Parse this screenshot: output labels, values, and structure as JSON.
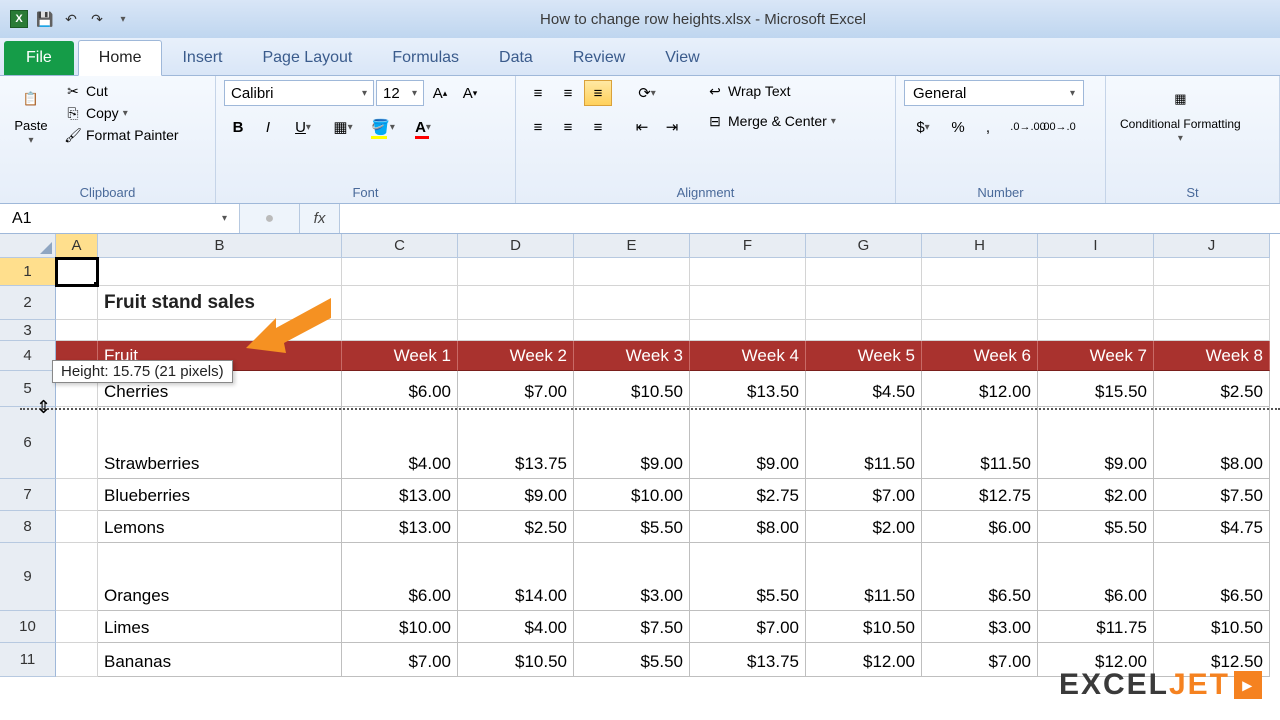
{
  "titlebar": {
    "title": "How to change row heights.xlsx - Microsoft Excel"
  },
  "tabs": {
    "file": "File",
    "home": "Home",
    "insert": "Insert",
    "pagelayout": "Page Layout",
    "formulas": "Formulas",
    "data": "Data",
    "review": "Review",
    "view": "View"
  },
  "clipboard": {
    "paste": "Paste",
    "cut": "Cut",
    "copy": "Copy",
    "format_painter": "Format Painter",
    "label": "Clipboard"
  },
  "font": {
    "name": "Calibri",
    "size": "12",
    "label": "Font"
  },
  "alignment": {
    "wrap": "Wrap Text",
    "merge": "Merge & Center",
    "label": "Alignment"
  },
  "number": {
    "format": "General",
    "label": "Number"
  },
  "styles": {
    "cond": "Conditional Formatting",
    "label": "St"
  },
  "namebox": "A1",
  "tooltip": "Height: 15.75 (21 pixels)",
  "columns": [
    "A",
    "B",
    "C",
    "D",
    "E",
    "F",
    "G",
    "H",
    "I",
    "J"
  ],
  "row_numbers": [
    "1",
    "2",
    "3",
    "4",
    "5",
    "6",
    "7",
    "8",
    "9",
    "10",
    "11"
  ],
  "sheet_title": "Fruit stand sales",
  "table": {
    "headers": [
      "Fruit",
      "Week 1",
      "Week 2",
      "Week 3",
      "Week 4",
      "Week 5",
      "Week 6",
      "Week 7",
      "Week 8"
    ],
    "rows": [
      [
        "Cherries",
        "$6.00",
        "$7.00",
        "$10.50",
        "$13.50",
        "$4.50",
        "$12.00",
        "$15.50",
        "$2.50"
      ],
      [
        "Strawberries",
        "$4.00",
        "$13.75",
        "$9.00",
        "$9.00",
        "$11.50",
        "$11.50",
        "$9.00",
        "$8.00"
      ],
      [
        "Blueberries",
        "$13.00",
        "$9.00",
        "$10.00",
        "$2.75",
        "$7.00",
        "$12.75",
        "$2.00",
        "$7.50"
      ],
      [
        "Lemons",
        "$13.00",
        "$2.50",
        "$5.50",
        "$8.00",
        "$2.00",
        "$6.00",
        "$5.50",
        "$4.75"
      ],
      [
        "Oranges",
        "$6.00",
        "$14.00",
        "$3.00",
        "$5.50",
        "$11.50",
        "$6.50",
        "$6.00",
        "$6.50"
      ],
      [
        "Limes",
        "$10.00",
        "$4.00",
        "$7.50",
        "$7.00",
        "$10.50",
        "$3.00",
        "$11.75",
        "$10.50"
      ],
      [
        "Bananas",
        "$7.00",
        "$10.50",
        "$5.50",
        "$13.75",
        "$12.00",
        "$7.00",
        "$12.00",
        "$12.50"
      ]
    ]
  },
  "watermark": {
    "a": "EXCEL",
    "b": "JET"
  },
  "chart_data": {
    "type": "table",
    "title": "Fruit stand sales",
    "categories": [
      "Week 1",
      "Week 2",
      "Week 3",
      "Week 4",
      "Week 5",
      "Week 6",
      "Week 7",
      "Week 8"
    ],
    "series": [
      {
        "name": "Cherries",
        "values": [
          6.0,
          7.0,
          10.5,
          13.5,
          4.5,
          12.0,
          15.5,
          2.5
        ]
      },
      {
        "name": "Strawberries",
        "values": [
          4.0,
          13.75,
          9.0,
          9.0,
          11.5,
          11.5,
          9.0,
          8.0
        ]
      },
      {
        "name": "Blueberries",
        "values": [
          13.0,
          9.0,
          10.0,
          2.75,
          7.0,
          12.75,
          2.0,
          7.5
        ]
      },
      {
        "name": "Lemons",
        "values": [
          13.0,
          2.5,
          5.5,
          8.0,
          2.0,
          6.0,
          5.5,
          4.75
        ]
      },
      {
        "name": "Oranges",
        "values": [
          6.0,
          14.0,
          3.0,
          5.5,
          11.5,
          6.5,
          6.0,
          6.5
        ]
      },
      {
        "name": "Limes",
        "values": [
          10.0,
          4.0,
          7.5,
          7.0,
          10.5,
          3.0,
          11.75,
          10.5
        ]
      },
      {
        "name": "Bananas",
        "values": [
          7.0,
          10.5,
          5.5,
          13.75,
          12.0,
          7.0,
          12.0,
          12.5
        ]
      }
    ]
  }
}
